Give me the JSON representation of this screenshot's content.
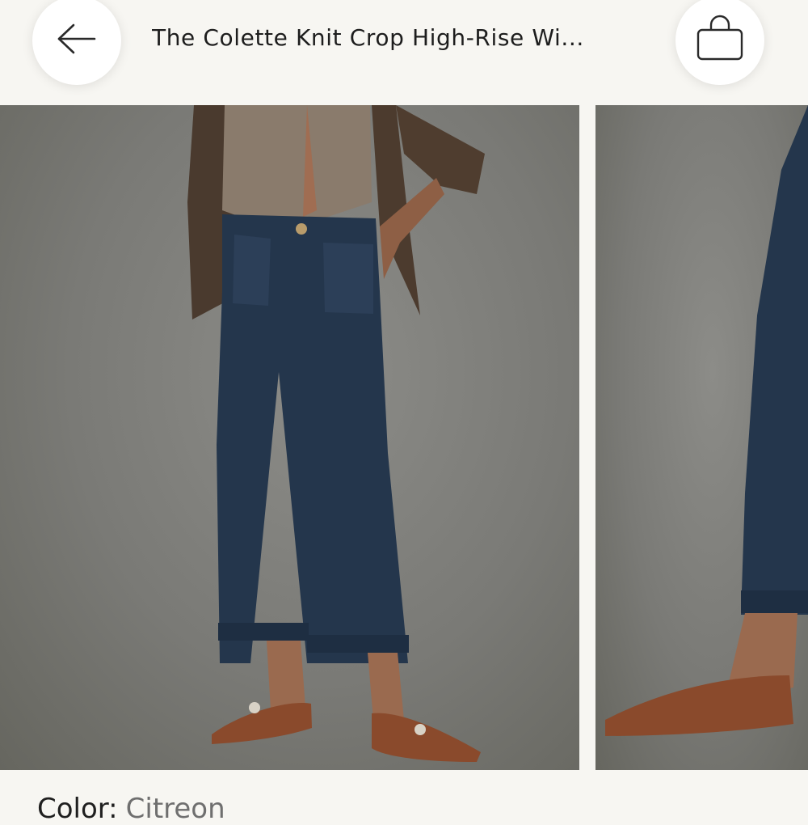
{
  "header": {
    "title": "The Colette Knit Crop High-Rise Wi...",
    "back_icon": "arrow-left-icon",
    "bag_icon": "shopping-bag-icon"
  },
  "gallery": {
    "images": [
      {
        "alt": "Model wearing dark wash wide-leg cropped jeans with brown suede flats, front view"
      },
      {
        "alt": "Model wearing dark wash wide-leg cropped jeans, side view"
      }
    ]
  },
  "product": {
    "color_label": "Color:",
    "color_value": "Citreon"
  },
  "colors": {
    "background": "#f7f6f2",
    "denim": "#22344a",
    "suede": "#8a4a2c",
    "backdrop": "#7d7d79"
  }
}
